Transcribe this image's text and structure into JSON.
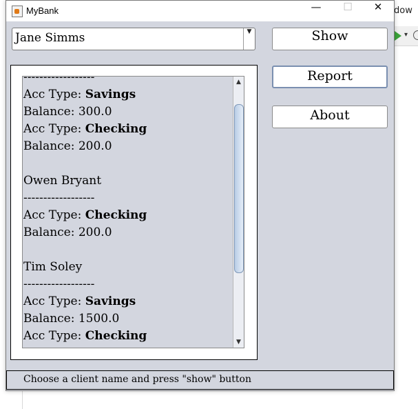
{
  "background": {
    "menu_fragment": "dow"
  },
  "window": {
    "title": "MyBank",
    "minimize_glyph": "—",
    "maximize_glyph": "☐",
    "close_glyph": "✕"
  },
  "client_select": {
    "value": "Jane Simms",
    "arrow": "▼"
  },
  "buttons": {
    "show": "Show",
    "report": "Report",
    "about": "About"
  },
  "report_text": {
    "lines": [
      {
        "text": "------------------"
      },
      {
        "label": "Acc Type: ",
        "bold": "Savings"
      },
      {
        "text": "Balance: 300.0"
      },
      {
        "label": "Acc Type: ",
        "bold": "Checking"
      },
      {
        "text": "Balance: 200.0"
      },
      {
        "text": ""
      },
      {
        "text": "Owen Bryant"
      },
      {
        "text": "------------------"
      },
      {
        "label": "Acc Type: ",
        "bold": "Checking"
      },
      {
        "text": "Balance: 200.0"
      },
      {
        "text": ""
      },
      {
        "text": "Tim Soley"
      },
      {
        "text": "------------------"
      },
      {
        "label": "Acc Type: ",
        "bold": "Savings"
      },
      {
        "text": "Balance: 1500.0"
      },
      {
        "label": "Acc Type: ",
        "bold": "Checking"
      }
    ]
  },
  "scrollbar": {
    "up": "▲",
    "down": "▼"
  },
  "status": {
    "text": "Choose a client name and press \"show\" button"
  },
  "colors": {
    "window_bg": "#d3d6df",
    "thumb": "#b9cde6"
  }
}
